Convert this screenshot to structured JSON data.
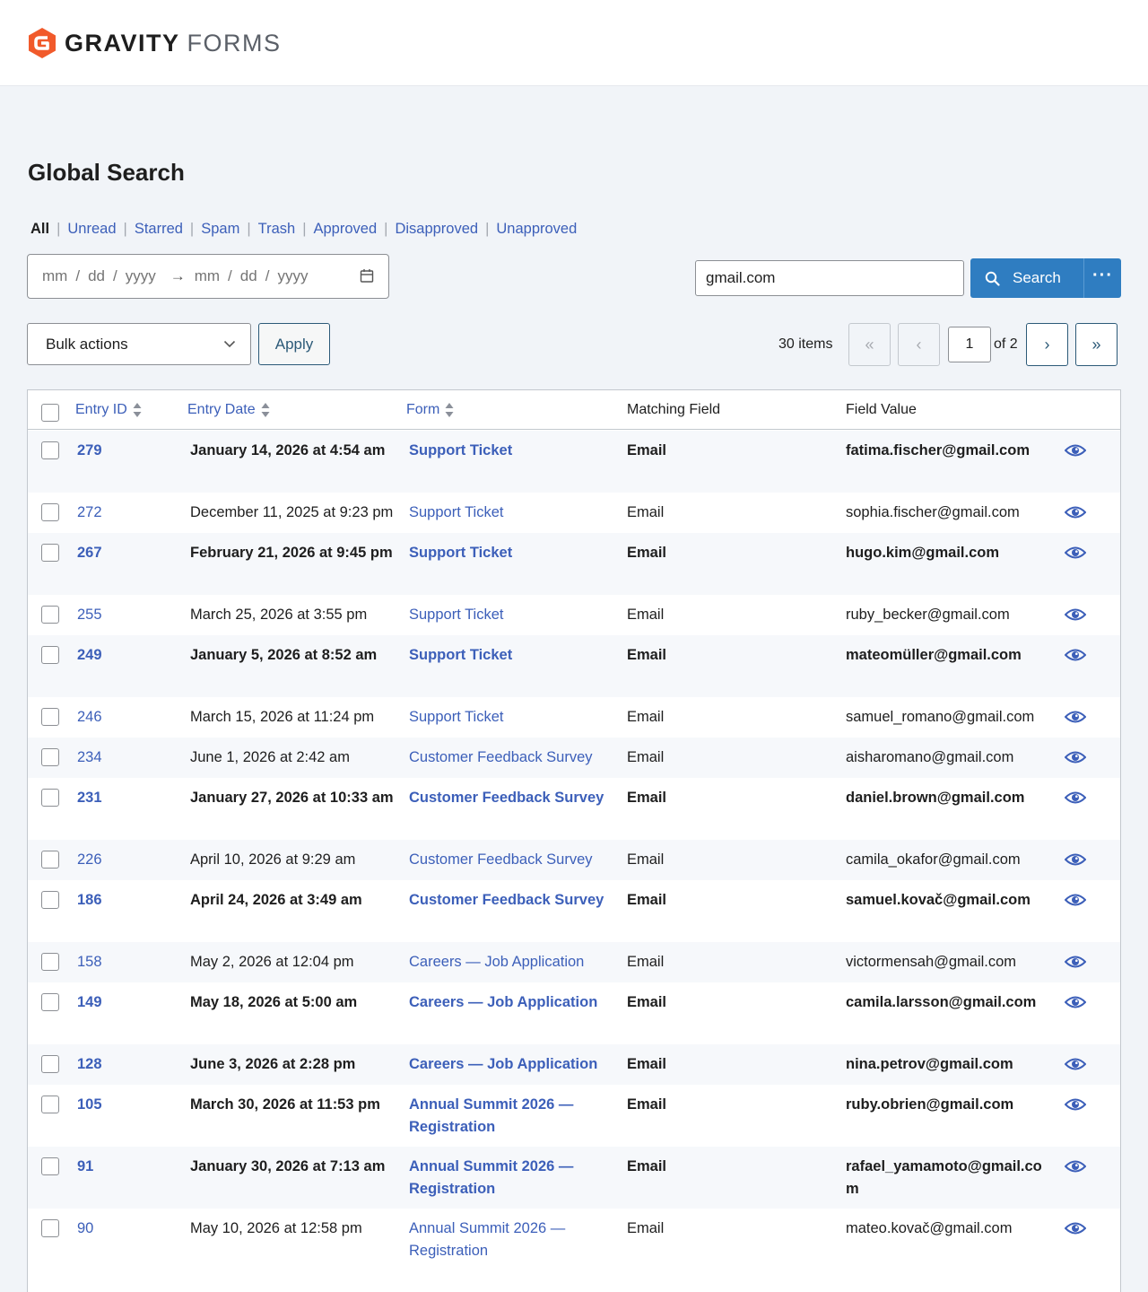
{
  "brand": {
    "word1": "GRAVITY",
    "word2": "FORMS",
    "accent": "#f15a2b"
  },
  "page_title": "Global Search",
  "filters": [
    {
      "label": "All",
      "current": true
    },
    {
      "label": "Unread"
    },
    {
      "label": "Starred"
    },
    {
      "label": "Spam"
    },
    {
      "label": "Trash"
    },
    {
      "label": "Approved"
    },
    {
      "label": "Disapproved"
    },
    {
      "label": "Unapproved"
    }
  ],
  "date_range": {
    "mm": "mm",
    "dd": "dd",
    "yyyy": "yyyy",
    "arrow": "→"
  },
  "search": {
    "value": "gmail.com",
    "button_label": "Search",
    "more_label": "···"
  },
  "bulk": {
    "label": "Bulk actions",
    "apply_label": "Apply"
  },
  "pagination": {
    "items": "30 items",
    "first": "«",
    "prev": "‹",
    "current": "1",
    "of": "of 2",
    "next": "›",
    "last": "»"
  },
  "columns": {
    "entry_id": "Entry ID",
    "entry_date": "Entry Date",
    "form": "Form",
    "matching_field": "Matching Field",
    "field_value": "Field Value"
  },
  "rows": [
    {
      "id": "279",
      "date": "January 14, 2026 at 4:54 am",
      "form": "Support Ticket",
      "field": "Email",
      "value": "fatima.fischer@gmail.com",
      "unread": true
    },
    {
      "id": "272",
      "date": "December 11, 2025 at 9:23 pm",
      "form": "Support Ticket",
      "field": "Email",
      "value": "sophia.fischer@gmail.com",
      "unread": false
    },
    {
      "id": "267",
      "date": "February 21, 2026 at 9:45 pm",
      "form": "Support Ticket",
      "field": "Email",
      "value": "hugo.kim@gmail.com",
      "unread": true
    },
    {
      "id": "255",
      "date": "March 25, 2026 at 3:55 pm",
      "form": "Support Ticket",
      "field": "Email",
      "value": "ruby_becker@gmail.com",
      "unread": false
    },
    {
      "id": "249",
      "date": "January 5, 2026 at 8:52 am",
      "form": "Support Ticket",
      "field": "Email",
      "value": "mateomüller@gmail.com",
      "unread": true
    },
    {
      "id": "246",
      "date": "March 15, 2026 at 11:24 pm",
      "form": "Support Ticket",
      "field": "Email",
      "value": "samuel_romano@gmail.com",
      "unread": false
    },
    {
      "id": "234",
      "date": "June 1, 2026 at 2:42 am",
      "form": "Customer Feedback Survey",
      "field": "Email",
      "value": "aisharomano@gmail.com",
      "unread": false
    },
    {
      "id": "231",
      "date": "January 27, 2026 at 10:33 am",
      "form": "Customer Feedback Survey",
      "field": "Email",
      "value": "daniel.brown@gmail.com",
      "unread": true
    },
    {
      "id": "226",
      "date": "April 10, 2026 at 9:29 am",
      "form": "Customer Feedback Survey",
      "field": "Email",
      "value": "camila_okafor@gmail.com",
      "unread": false
    },
    {
      "id": "186",
      "date": "April 24, 2026 at 3:49 am",
      "form": "Customer Feedback Survey",
      "field": "Email",
      "value": "samuel.kovač@gmail.com",
      "unread": true
    },
    {
      "id": "158",
      "date": "May 2, 2026 at 12:04 pm",
      "form": "Careers — Job Application",
      "field": "Email",
      "value": "victormensah@gmail.com",
      "unread": false
    },
    {
      "id": "149",
      "date": "May 18, 2026 at 5:00 am",
      "form": "Careers — Job Application",
      "field": "Email",
      "value": "camila.larsson@gmail.com",
      "unread": true
    },
    {
      "id": "128",
      "date": "June 3, 2026 at 2:28 pm",
      "form": "Careers — Job Application",
      "field": "Email",
      "value": "nina.petrov@gmail.com",
      "unread": true
    },
    {
      "id": "105",
      "date": "March 30, 2026 at 11:53 pm",
      "form": "Annual Summit 2026 — Registration",
      "field": "Email",
      "value": "ruby.obrien@gmail.com",
      "unread": true
    },
    {
      "id": "91",
      "date": "January 30, 2026 at 7:13 am",
      "form": "Annual Summit 2026 — Registration",
      "field": "Email",
      "value": "rafael_yamamoto@gmail.com",
      "unread": true
    },
    {
      "id": "90",
      "date": "May 10, 2026 at 12:58 pm",
      "form": "Annual Summit 2026 — Registration",
      "field": "Email",
      "value": "mateo.kovač@gmail.com",
      "unread": false
    }
  ]
}
